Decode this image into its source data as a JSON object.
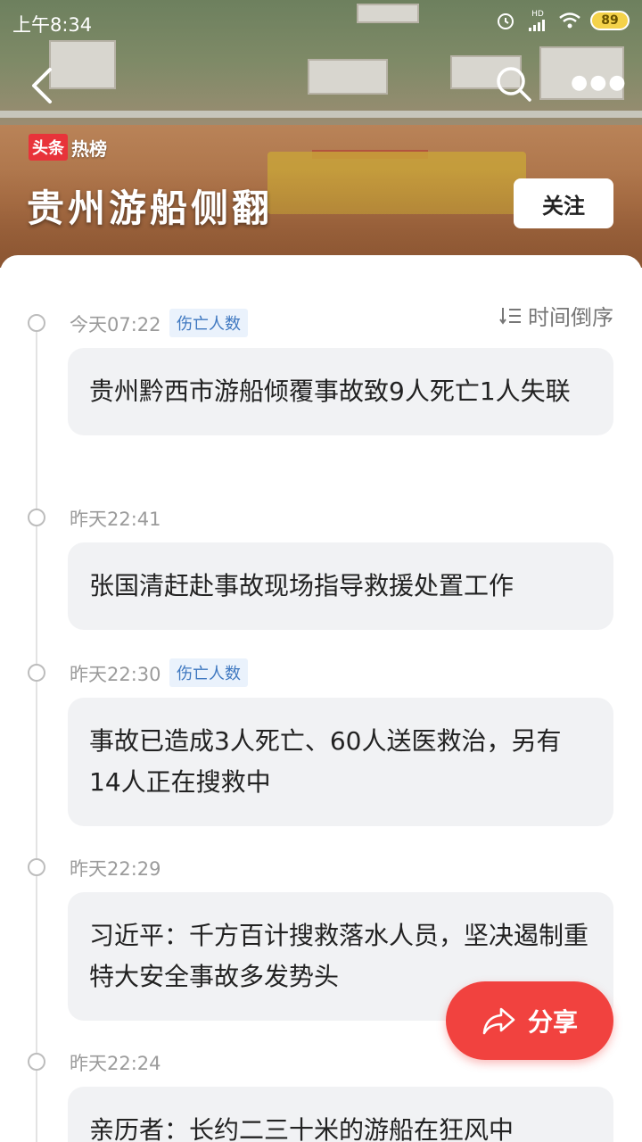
{
  "status_bar": {
    "time": "上午8:34",
    "network": "HD",
    "battery": "89"
  },
  "header": {
    "brand_tag": "头条",
    "brand_text": "热榜",
    "title": "贵州游船侧翻",
    "follow_label": "关注"
  },
  "sort": {
    "label": "时间倒序"
  },
  "entries": [
    {
      "time": "今天07:22",
      "tag": "伤亡人数",
      "text": "贵州黔西市游船倾覆事故致9人死亡1人失联"
    },
    {
      "time": "昨天22:41",
      "tag": "",
      "text": "张国清赶赴事故现场指导救援处置工作"
    },
    {
      "time": "昨天22:30",
      "tag": "伤亡人数",
      "text": "事故已造成3人死亡、60人送医救治，另有14人正在搜救中"
    },
    {
      "time": "昨天22:29",
      "tag": "",
      "text": "习近平：千方百计搜救落水人员，坚决遏制重特大安全事故多发势头"
    },
    {
      "time": "昨天22:24",
      "tag": "",
      "text": "亲历者：长约二三十米的游船在狂风中"
    }
  ],
  "share": {
    "label": "分享"
  },
  "colors": {
    "accent": "#f1423f",
    "tag_text": "#3f78c0",
    "tag_bg": "#eaf2fc",
    "card_bg": "#f1f2f4"
  }
}
